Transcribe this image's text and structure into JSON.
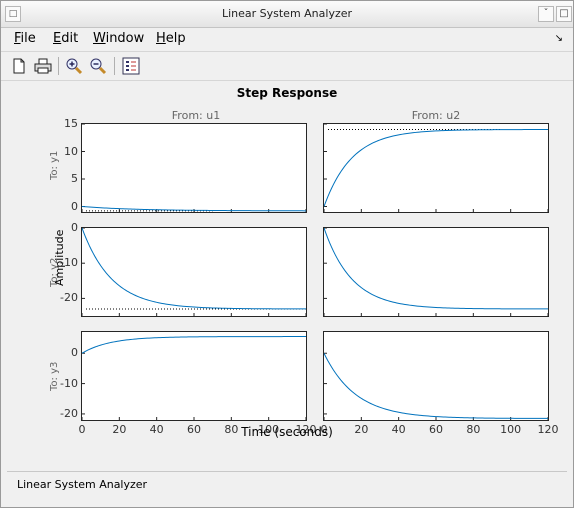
{
  "window": {
    "title": "Linear System Analyzer"
  },
  "menu": {
    "items": [
      {
        "label": "File",
        "accel": "F",
        "rest": "ile"
      },
      {
        "label": "Edit",
        "accel": "E",
        "rest": "dit"
      },
      {
        "label": "Window",
        "accel": "W",
        "rest": "indow"
      },
      {
        "label": "Help",
        "accel": "H",
        "rest": "elp"
      }
    ]
  },
  "toolbar": {
    "icons": [
      "new-file-icon",
      "print-icon",
      "zoom-in-icon",
      "zoom-out-icon",
      "plot-configurations-icon"
    ]
  },
  "chart_data": {
    "type": "line",
    "title": "Step Response",
    "xlabel": "Time (seconds)",
    "ylabel": "Amplitude",
    "columns": [
      "From: u1",
      "From: u2"
    ],
    "rows": [
      "To: y1",
      "To: y2",
      "To: y3"
    ],
    "xlim": [
      0,
      120
    ],
    "xticks": [
      "0",
      "20",
      "40",
      "60",
      "80",
      "100",
      "120"
    ],
    "row_ylims": [
      [
        -1,
        15
      ],
      [
        -25,
        0
      ],
      [
        -22,
        7
      ]
    ],
    "row_yticks": [
      [
        "15",
        "10",
        "5",
        "0"
      ],
      [
        "0",
        "-10",
        "-20"
      ],
      [
        "0",
        "-10",
        "-20"
      ]
    ],
    "color": "#0072bd",
    "subplots": [
      {
        "row": 0,
        "col": 0,
        "initial": 0,
        "final": -0.8,
        "tau": 30,
        "steady_line": -0.8,
        "steady_line_end": 70
      },
      {
        "row": 0,
        "col": 1,
        "initial": 0,
        "final": 14,
        "tau": 15,
        "steady_line": 14,
        "steady_line_end": 95
      },
      {
        "row": 1,
        "col": 0,
        "initial": 0,
        "final": -23,
        "tau": 16,
        "steady_line": -23,
        "steady_line_end": 120
      },
      {
        "row": 1,
        "col": 1,
        "initial": 0,
        "final": -23,
        "tau": 15,
        "steady_line": null,
        "steady_line_end": null
      },
      {
        "row": 2,
        "col": 0,
        "initial": 0,
        "final": 5.5,
        "tau": 15,
        "steady_line": null,
        "steady_line_end": null
      },
      {
        "row": 2,
        "col": 1,
        "initial": 0,
        "final": -21.5,
        "tau": 17,
        "steady_line": null,
        "steady_line_end": null
      }
    ]
  },
  "status": {
    "text": "Linear System Analyzer"
  }
}
